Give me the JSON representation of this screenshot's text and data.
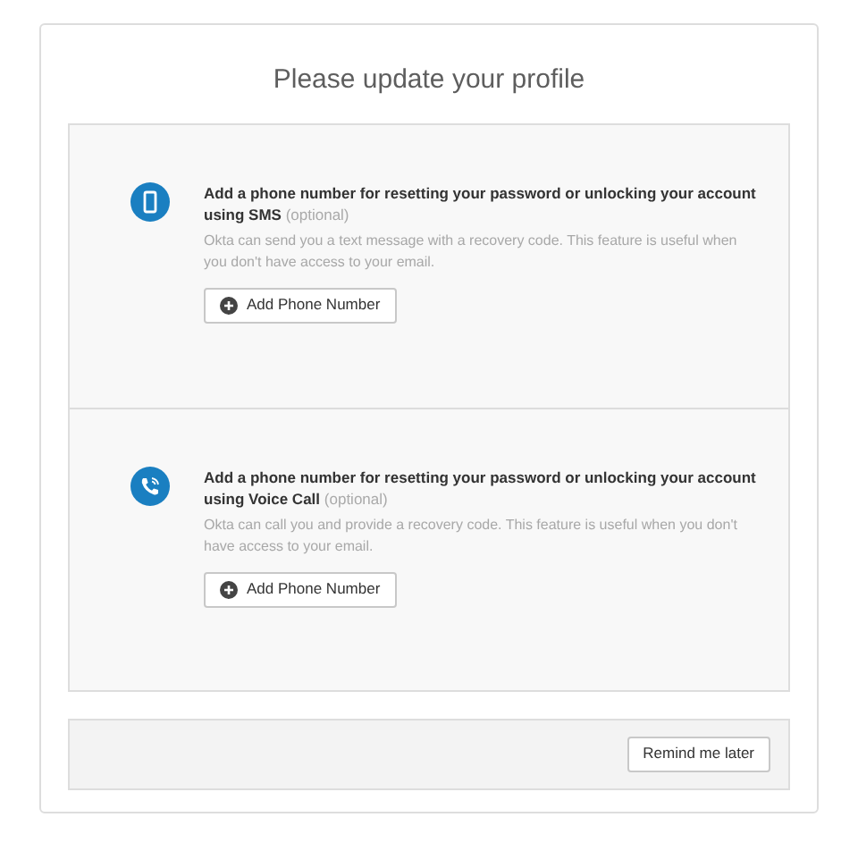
{
  "title": "Please update your profile",
  "sections": [
    {
      "kind": "sms",
      "heading": "Add a phone number for resetting your password or unlocking your account using SMS",
      "optional": "(optional)",
      "description": "Okta can send you a text message with a recovery code. This feature is useful when you don't have access to your email.",
      "button": "Add Phone Number"
    },
    {
      "kind": "voice",
      "heading": "Add a phone number for resetting your password or unlocking your account using Voice Call",
      "optional": "(optional)",
      "description": "Okta can call you and provide a recovery code. This feature is useful when you don't have access to your email.",
      "button": "Add Phone Number"
    }
  ],
  "footer_button": "Remind me later"
}
